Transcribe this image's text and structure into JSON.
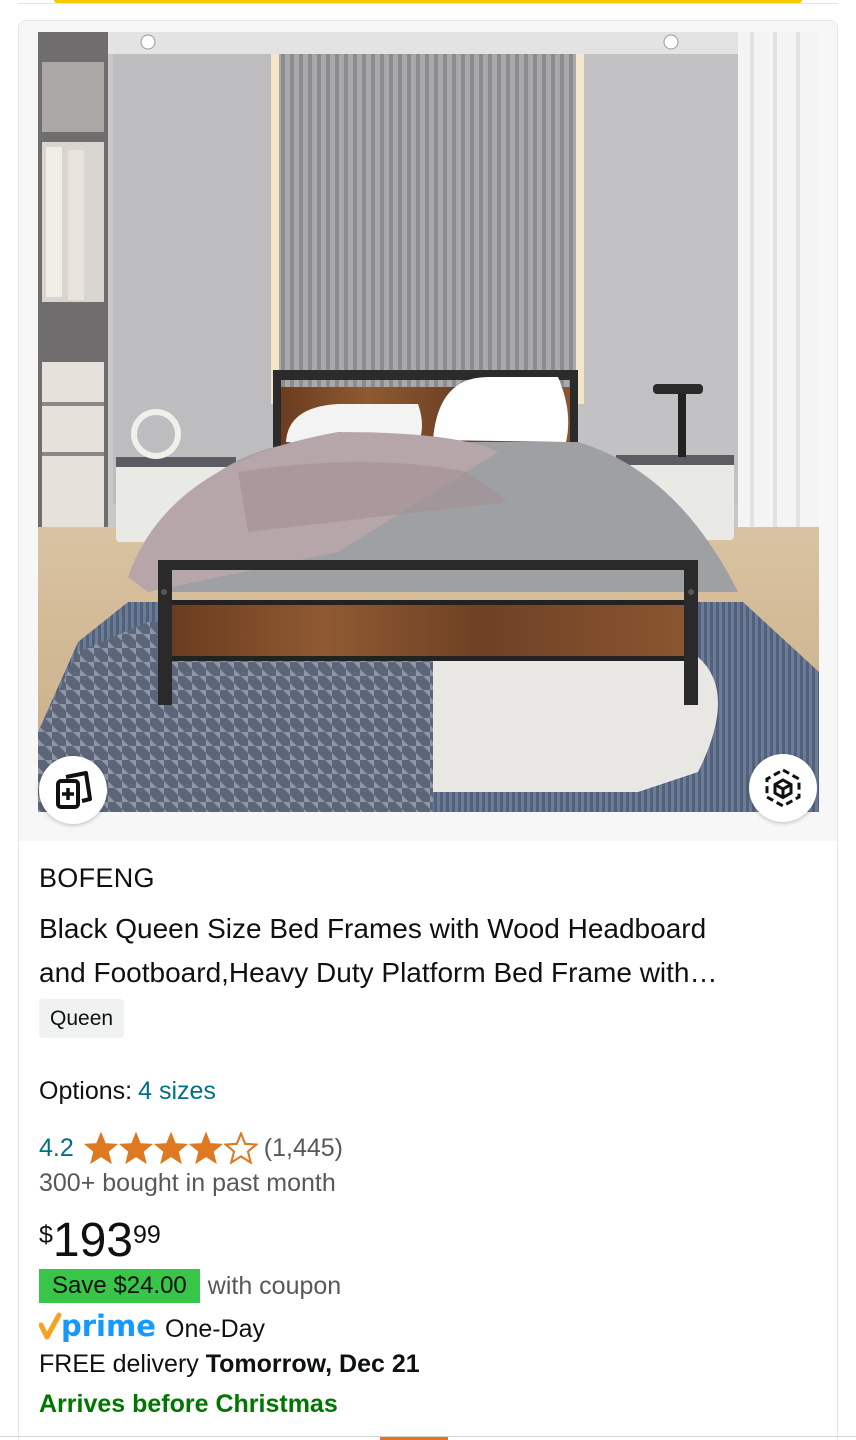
{
  "product": {
    "brand": "BOFENG",
    "title_line1": "Black Queen Size Bed Frames with Wood Headboard",
    "title_line2": "and Footboard,Heavy Duty Platform Bed Frame with…",
    "size_badge": "Queen",
    "options_label": "Options:",
    "options_link": "4 sizes",
    "rating": "4.2",
    "rating_stars_filled": 4,
    "rating_count": "(1,445)",
    "bought_text": "300+ bought in past month",
    "price_symbol": "$",
    "price_whole": "193",
    "price_fraction": "99",
    "coupon_label": "Save $24.00",
    "coupon_suffix": "with coupon",
    "prime_label": "prime",
    "prime_speed": "One-Day",
    "delivery_prefix": "FREE delivery ",
    "delivery_date": "Tomorrow, Dec 21",
    "arrives_text": "Arrives before Christmas"
  },
  "icons": {
    "compare": "compare-icon",
    "view_3d": "view-in-3d-icon",
    "star": "star-icon",
    "prime_check": "prime-check-icon"
  },
  "colors": {
    "link": "#007185",
    "star": "#de7921",
    "prime": "#1399ff",
    "prime_check": "#f7a221",
    "coupon_bg": "#38c548",
    "arrives": "#007600"
  }
}
